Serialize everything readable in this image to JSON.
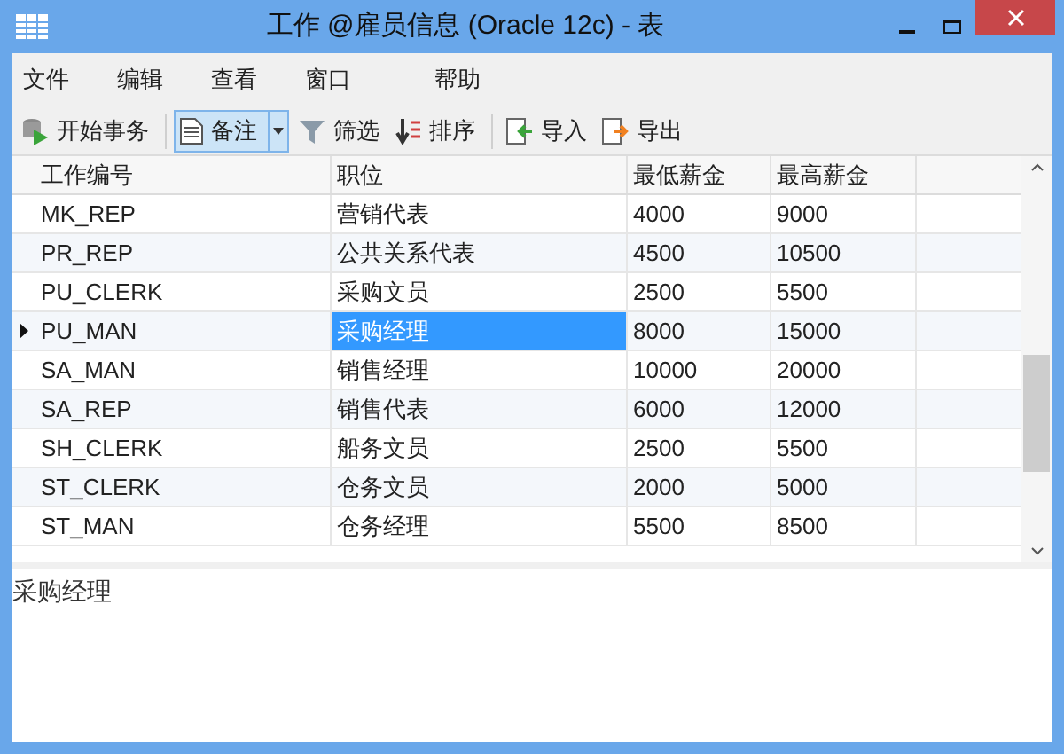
{
  "window": {
    "title": "工作 @雇员信息 (Oracle 12c) - 表"
  },
  "menu": [
    "文件",
    "编辑",
    "查看",
    "窗口",
    "帮助"
  ],
  "toolbar": [
    {
      "kind": "begin",
      "label": "开始事务",
      "pressed": false
    },
    {
      "kind": "memo",
      "label": "备注",
      "pressed": true
    },
    {
      "kind": "filter",
      "label": "筛选",
      "pressed": false
    },
    {
      "kind": "sort",
      "label": "排序",
      "pressed": false
    },
    {
      "kind": "import",
      "label": "导入",
      "pressed": false
    },
    {
      "kind": "export",
      "label": "导出",
      "pressed": false
    }
  ],
  "table": {
    "columns": [
      "工作编号",
      "职位",
      "最低薪金",
      "最高薪金"
    ],
    "rows": [
      {
        "selected": false,
        "cells": [
          {
            "text": "MK_REP",
            "selected": false
          },
          {
            "text": "营销代表",
            "selected": false
          },
          {
            "text": "4000",
            "selected": false
          },
          {
            "text": "9000",
            "selected": false
          }
        ]
      },
      {
        "selected": false,
        "cells": [
          {
            "text": "PR_REP",
            "selected": false
          },
          {
            "text": "公共关系代表",
            "selected": false
          },
          {
            "text": "4500",
            "selected": false
          },
          {
            "text": "10500",
            "selected": false
          }
        ]
      },
      {
        "selected": false,
        "cells": [
          {
            "text": "PU_CLERK",
            "selected": false
          },
          {
            "text": "采购文员",
            "selected": false
          },
          {
            "text": "2500",
            "selected": false
          },
          {
            "text": "5500",
            "selected": false
          }
        ]
      },
      {
        "selected": true,
        "cells": [
          {
            "text": "PU_MAN",
            "selected": false
          },
          {
            "text": "采购经理",
            "selected": true
          },
          {
            "text": "8000",
            "selected": false
          },
          {
            "text": "15000",
            "selected": false
          }
        ]
      },
      {
        "selected": false,
        "cells": [
          {
            "text": "SA_MAN",
            "selected": false
          },
          {
            "text": "销售经理",
            "selected": false
          },
          {
            "text": "10000",
            "selected": false
          },
          {
            "text": "20000",
            "selected": false
          }
        ]
      },
      {
        "selected": false,
        "cells": [
          {
            "text": "SA_REP",
            "selected": false
          },
          {
            "text": "销售代表",
            "selected": false
          },
          {
            "text": "6000",
            "selected": false
          },
          {
            "text": "12000",
            "selected": false
          }
        ]
      },
      {
        "selected": false,
        "cells": [
          {
            "text": "SH_CLERK",
            "selected": false
          },
          {
            "text": "船务文员",
            "selected": false
          },
          {
            "text": "2500",
            "selected": false
          },
          {
            "text": "5500",
            "selected": false
          }
        ]
      },
      {
        "selected": false,
        "cells": [
          {
            "text": "ST_CLERK",
            "selected": false
          },
          {
            "text": "仓务文员",
            "selected": false
          },
          {
            "text": "2000",
            "selected": false
          },
          {
            "text": "5000",
            "selected": false
          }
        ]
      },
      {
        "selected": false,
        "cells": [
          {
            "text": "ST_MAN",
            "selected": false
          },
          {
            "text": "仓务经理",
            "selected": false
          },
          {
            "text": "5500",
            "selected": false
          },
          {
            "text": "8500",
            "selected": false
          }
        ]
      }
    ]
  },
  "memo": {
    "text": "采购经理"
  }
}
